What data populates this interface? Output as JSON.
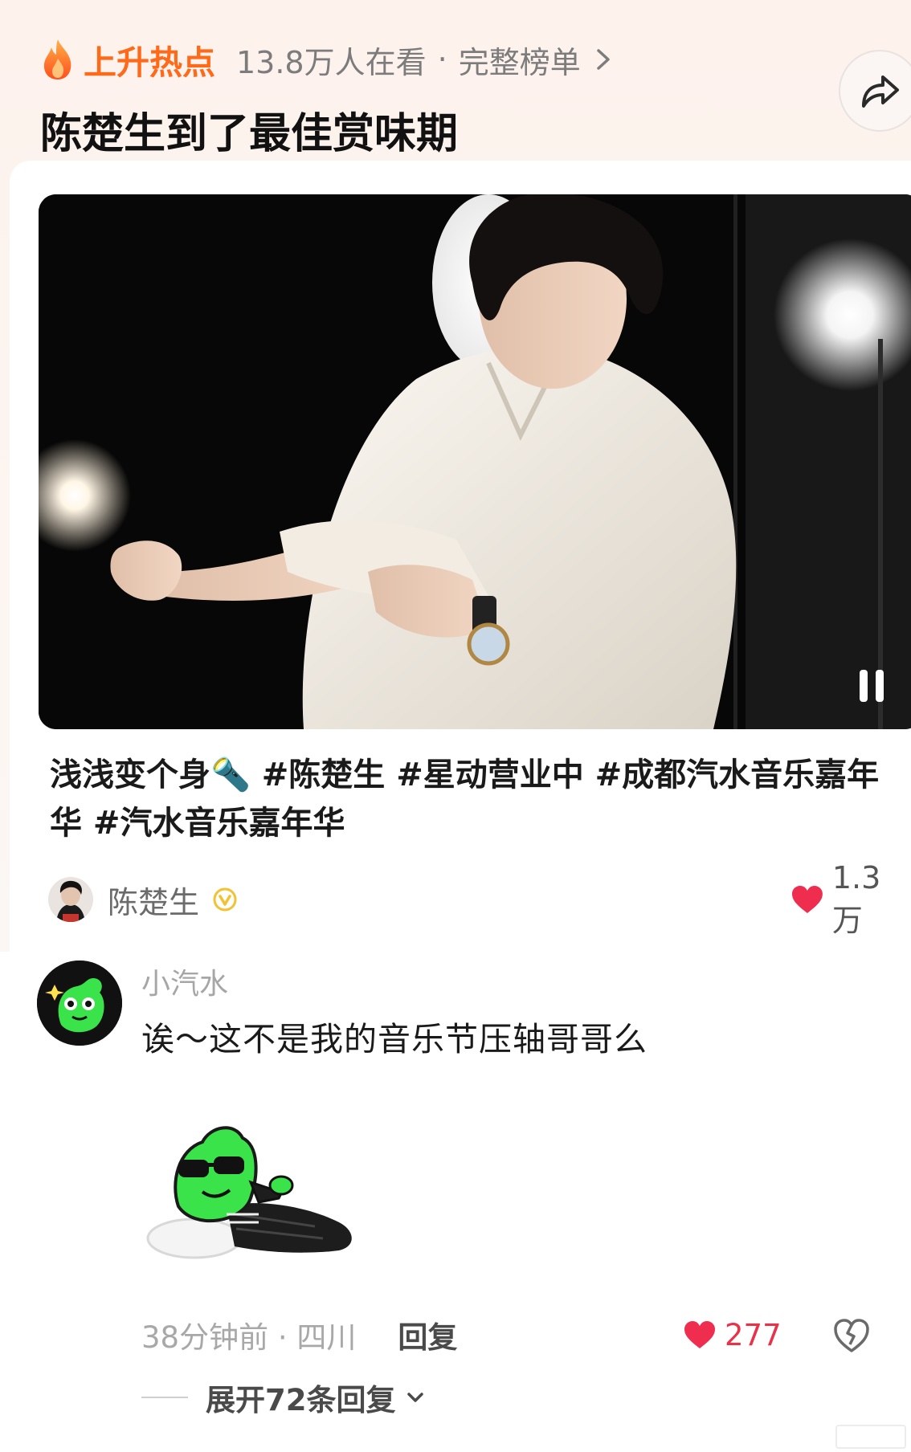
{
  "hot": {
    "label": "上升热点",
    "viewers": "13.8万人在看",
    "separator": "·",
    "full_list": "完整榜单"
  },
  "headline": "陈楚生到了最佳赏味期",
  "post": {
    "text_intro": "浅浅变个身🔦",
    "hashtags": "#陈楚生 #星动营业中 #成都汽水音乐嘉年华 #汽水音乐嘉年华"
  },
  "author": {
    "name": "陈楚生",
    "likes": "1.3万"
  },
  "comment": {
    "user": "小汽水",
    "text": "诶～这不是我的音乐节压轴哥哥么",
    "meta": "38分钟前 · 四川",
    "reply_label": "回复",
    "likes": "277",
    "expand_label": "展开72条回复"
  },
  "colors": {
    "accent_orange": "#ff6a1a",
    "like_red": "#e8324a",
    "sticker_green": "#3be34b"
  }
}
